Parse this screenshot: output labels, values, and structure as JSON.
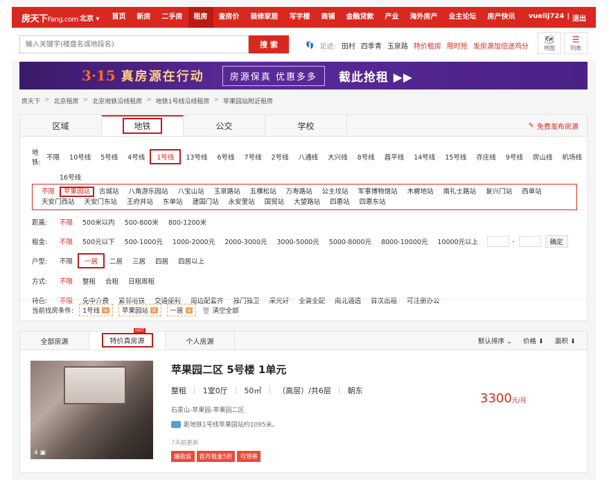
{
  "nav": {
    "logo": "房天下",
    "logo_sub": "Fang.com",
    "city": "北京 ▾",
    "items": [
      "首页",
      "新房",
      "二手房",
      "租房",
      "查房价",
      "装修家居",
      "写字楼",
      "商铺",
      "金融贷款",
      "产业",
      "海外房产",
      "业主论坛",
      "房产快讯"
    ],
    "user": "vuelij724",
    "sep": "|",
    "logout": "退出"
  },
  "search": {
    "placeholder": "输入关键字(楼盘名或地段名)",
    "button": "搜 索",
    "footprint_label": "足迹:",
    "footprint": [
      "田村",
      "四季青",
      "玉泉路"
    ],
    "promos": [
      "特价租房",
      "限时抢",
      "发房源加倍送鸡分"
    ],
    "map_label": "地图",
    "list_label": "列表"
  },
  "banner": {
    "t1": "3·15",
    "t2": "真房源在行动",
    "t3": "房源保真 优惠多多",
    "t4": "截此抢租 ▶▶"
  },
  "breadcrumb": [
    "房天下",
    "北京租房",
    "北京地铁沿线租房",
    "地铁1号线沿线租房",
    "苹果园站附近租房"
  ],
  "breadcrumb_sep": ">",
  "tabs": [
    "区域",
    "地铁",
    "公交",
    "学校"
  ],
  "publish_label": "免费发布房源",
  "subway": {
    "label": "地铁:",
    "lines": [
      "不限",
      "10号线",
      "5号线",
      "4号线",
      "1号线",
      "13号线",
      "6号线",
      "7号线",
      "2号线",
      "八通线",
      "大兴线",
      "8号线",
      "昌平线",
      "14号线",
      "15号线",
      "亦庄线",
      "9号线",
      "房山线",
      "机场线",
      "16号线"
    ]
  },
  "stations": [
    "不限",
    "苹果园站",
    "古城站",
    "八角游乐园站",
    "八宝山站",
    "玉泉路站",
    "五棵松站",
    "万寿路站",
    "公主坟站",
    "军事博物馆站",
    "木樨地站",
    "南礼士路站",
    "复兴门站",
    "西单站",
    "天安门西站",
    "天安门东站",
    "王府井站",
    "东单站",
    "建国门站",
    "永安里站",
    "国贸站",
    "大望路站",
    "四惠站",
    "四惠东站"
  ],
  "distance": {
    "label": "距离:",
    "options": [
      "不限",
      "500米以内",
      "500-800米",
      "800-1200米"
    ]
  },
  "rent": {
    "label": "租金:",
    "options": [
      "不限",
      "500元以下",
      "500-1000元",
      "1000-2000元",
      "2000-3000元",
      "3000-5000元",
      "5000-8000元",
      "8000-10000元",
      "10000元以上"
    ],
    "dash": "-",
    "ok": "确定"
  },
  "layout": {
    "label": "户型:",
    "options": [
      "不限",
      "一居",
      "二居",
      "三居",
      "四居",
      "四居以上"
    ]
  },
  "mode": {
    "label": "方式:",
    "options": [
      "不限",
      "整租",
      "合租",
      "日租周租"
    ]
  },
  "feature": {
    "label": "特色:",
    "options": [
      "不限",
      "免中介费",
      "紧邻地铁",
      "交通便利",
      "周边配套齐",
      "独门独卫",
      "采光好",
      "全装全配",
      "南北通透",
      "首次出租",
      "可注册办公"
    ]
  },
  "current": {
    "label": "当前找房条件:",
    "tags": [
      "1号线",
      "苹果园站",
      "一居"
    ],
    "clear": "清空全部",
    "x": "×"
  },
  "list_tabs": [
    "全部房源",
    "特价真房源",
    "个人房源"
  ],
  "hot_badge": "HOT",
  "sorts": [
    "默认排序 ⌄",
    "价格 ⬇",
    "面积 ⬇"
  ],
  "listing": {
    "title": "苹果园二区 5号楼 1单元",
    "attrs": [
      "整租",
      "1室0厅",
      "50㎡",
      "（高层）/共6层",
      "朝东"
    ],
    "attr_sep": "|",
    "address": "石景山-苹果园-苹果园二区",
    "subway": "距地铁1号线苹果园站约1095米。",
    "updated": "7天前更新",
    "tags": [
      "爆款房",
      "首月租金5折",
      "可领券"
    ],
    "price": "3300",
    "unit": "元/月",
    "photo_count": "4 ▣"
  }
}
